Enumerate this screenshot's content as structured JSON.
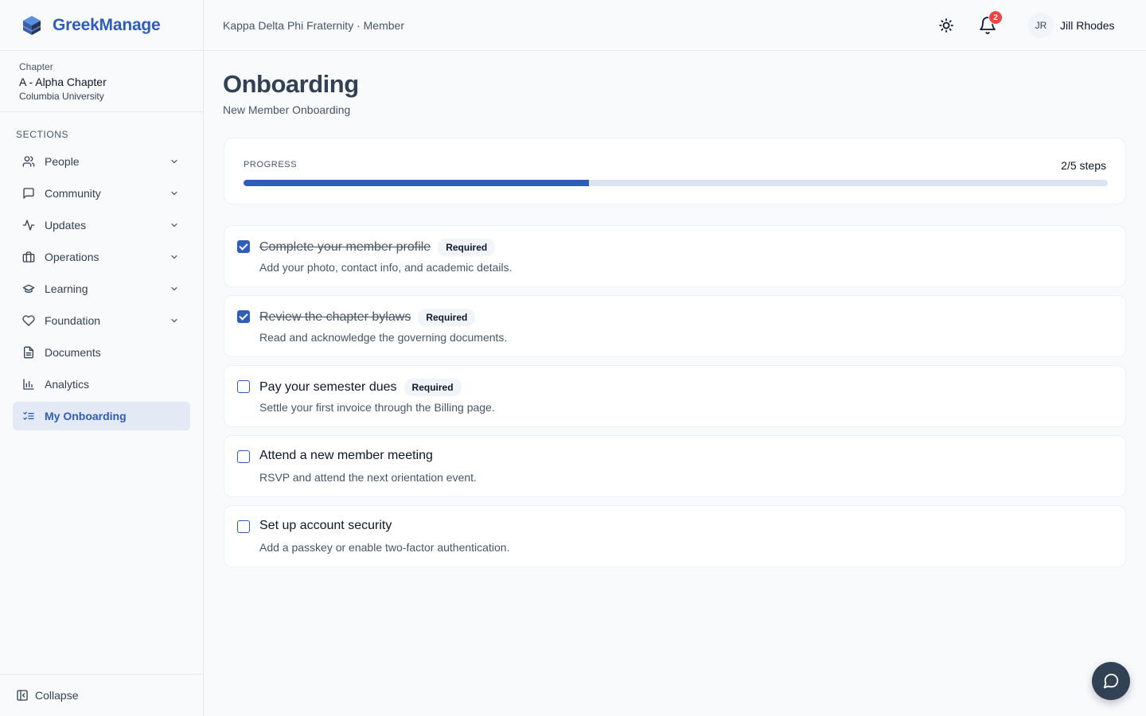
{
  "app": {
    "name": "GreekManage"
  },
  "chapter": {
    "kicker": "Chapter",
    "name": "A - Alpha Chapter",
    "school": "Columbia University"
  },
  "sidebar": {
    "sections_label": "SECTIONS",
    "items": [
      {
        "label": "People",
        "icon": "users-icon",
        "expandable": true
      },
      {
        "label": "Community",
        "icon": "message-square-icon",
        "expandable": true
      },
      {
        "label": "Updates",
        "icon": "activity-icon",
        "expandable": true
      },
      {
        "label": "Operations",
        "icon": "briefcase-icon",
        "expandable": true
      },
      {
        "label": "Learning",
        "icon": "graduation-cap-icon",
        "expandable": true
      },
      {
        "label": "Foundation",
        "icon": "heart-icon",
        "expandable": true
      },
      {
        "label": "Documents",
        "icon": "file-text-icon",
        "expandable": false
      },
      {
        "label": "Analytics",
        "icon": "bar-chart-icon",
        "expandable": false
      },
      {
        "label": "My Onboarding",
        "icon": "list-checks-icon",
        "expandable": false,
        "active": true
      }
    ],
    "collapse_label": "Collapse"
  },
  "topbar": {
    "org_line": "Kappa Delta Phi Fraternity · Member",
    "notification_count": "2",
    "user_initials": "JR",
    "user_name": "Jill Rhodes"
  },
  "page": {
    "title": "Onboarding",
    "subtitle": "New Member Onboarding"
  },
  "progress": {
    "label": "PROGRESS",
    "count_text": "2/5 steps",
    "fraction": 0.4
  },
  "steps": [
    {
      "title": "Complete your member profile",
      "required": "Required",
      "description": "Add your photo, contact info, and academic details.",
      "done": true
    },
    {
      "title": "Review the chapter bylaws",
      "required": "Required",
      "description": "Read and acknowledge the governing documents.",
      "done": true
    },
    {
      "title": "Pay your semester dues",
      "required": "Required",
      "description": "Settle your first invoice through the Billing page.",
      "done": false
    },
    {
      "title": "Attend a new member meeting",
      "required": "",
      "description": "RSVP and attend the next orientation event.",
      "done": false
    },
    {
      "title": "Set up account security",
      "required": "",
      "description": "Add a passkey or enable two-factor authentication.",
      "done": false
    }
  ],
  "colors": {
    "accent": "#2f5db9",
    "active_bg": "#e3e9f5",
    "badge": "#ef4444"
  }
}
